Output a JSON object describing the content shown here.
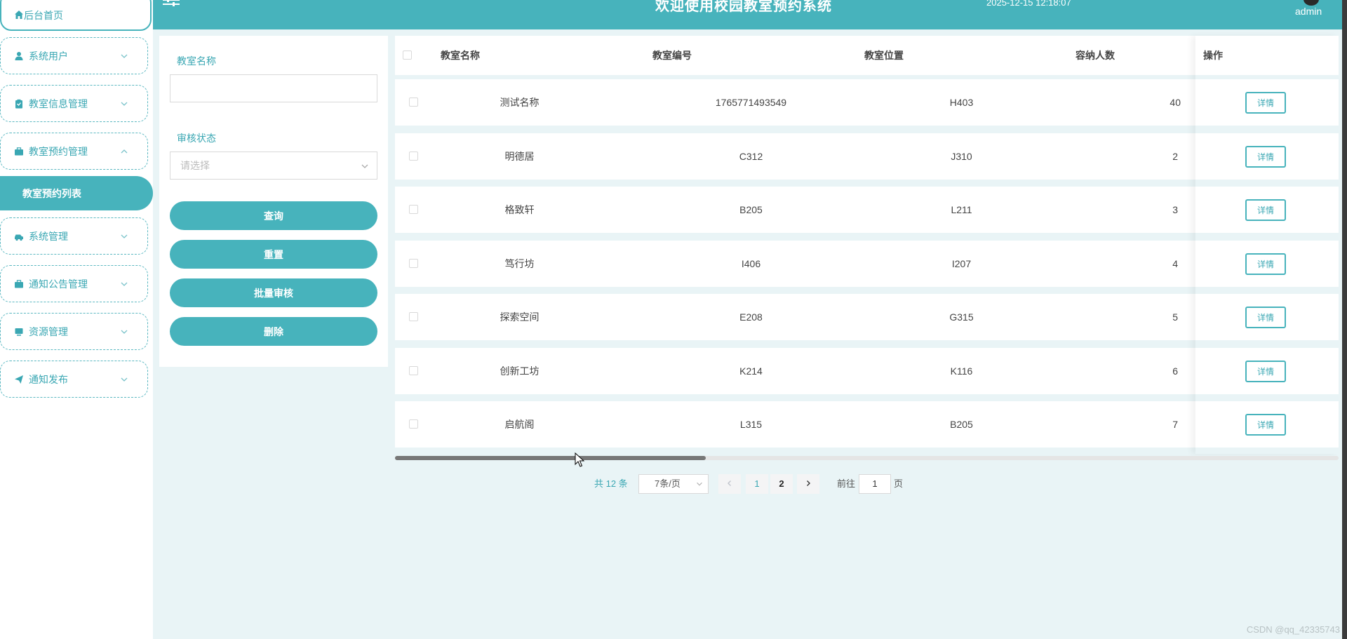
{
  "header": {
    "title": "欢迎使用校园教室预约系统",
    "datetime": "2025-12-15 12:18:07",
    "username": "admin"
  },
  "sidebar": {
    "home": "后台首页",
    "items": [
      {
        "label": "系统用户",
        "icon": "user-icon"
      },
      {
        "label": "教室信息管理",
        "icon": "clipboard-icon"
      },
      {
        "label": "教室预约管理",
        "icon": "briefcase-icon",
        "expanded": true
      },
      {
        "label": "系统管理",
        "icon": "car-icon"
      },
      {
        "label": "通知公告管理",
        "icon": "briefcase-icon"
      },
      {
        "label": "资源管理",
        "icon": "monitor-icon"
      },
      {
        "label": "通知发布",
        "icon": "send-icon"
      }
    ],
    "active_subitem": "教室预约列表"
  },
  "search": {
    "name_label": "教室名称",
    "name_value": "",
    "status_label": "审核状态",
    "status_placeholder": "请选择",
    "query_label": "查询",
    "reset_label": "重置",
    "batch_label": "批量审核",
    "delete_label": "删除"
  },
  "table": {
    "columns": [
      "教室名称",
      "教室编号",
      "教室位置",
      "容纳人数",
      "操作"
    ],
    "detail_label": "详情",
    "rows": [
      [
        "测试名称",
        "1765771493549",
        "H403",
        "40"
      ],
      [
        "明德居",
        "C312",
        "J310",
        "2"
      ],
      [
        "格致轩",
        "B205",
        "L211",
        "3"
      ],
      [
        "笃行坊",
        "I406",
        "I207",
        "4"
      ],
      [
        "探索空间",
        "E208",
        "G315",
        "5"
      ],
      [
        "创新工坊",
        "K214",
        "K116",
        "6"
      ],
      [
        "启航阁",
        "L315",
        "B205",
        "7"
      ]
    ]
  },
  "pagination": {
    "total": "共 12 条",
    "page_size": "7条/页",
    "pages": [
      "1",
      "2"
    ],
    "current_page": "2",
    "goto_label": "前往",
    "goto_value": "1",
    "page_unit": "页"
  },
  "watermark": "CSDN @qq_42335743",
  "colors": {
    "accent": "#47b3bc",
    "accent_text": "#3aa7b3",
    "background": "#e9f4f6"
  }
}
